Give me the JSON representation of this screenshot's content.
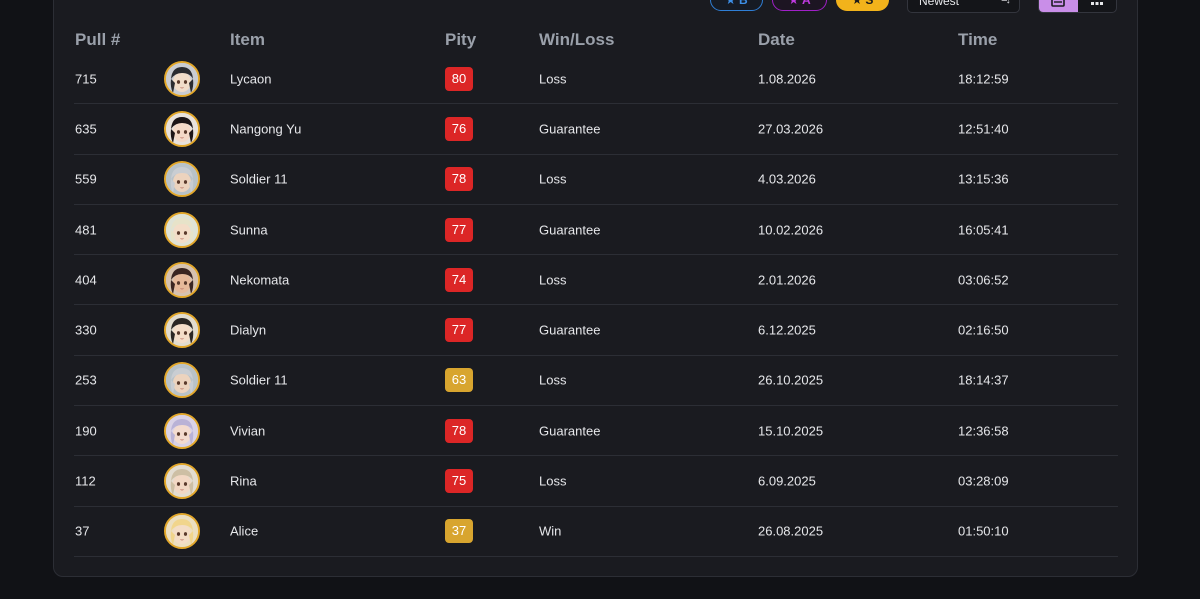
{
  "filters": {
    "b_label": "B",
    "a_label": "A",
    "s_label": "S",
    "colors": {
      "b": "#3d8fe6",
      "a": "#c03ae0",
      "s": "#f2b31b"
    }
  },
  "sort": {
    "selected": "Newest"
  },
  "view": {
    "options": [
      "list",
      "grid"
    ],
    "active": "list"
  },
  "table": {
    "headers": {
      "pull": "Pull #",
      "item": "Item",
      "pity": "Pity",
      "result": "Win/Loss",
      "date": "Date",
      "time": "Time"
    },
    "rows": [
      {
        "pull": "715",
        "item": "Lycaon",
        "pity": "80",
        "pity_level": "high",
        "result": "Loss",
        "date": "1.08.2026",
        "time": "18:12:59",
        "avatar": "lycaon-portrait"
      },
      {
        "pull": "635",
        "item": "Nangong Yu",
        "pity": "76",
        "pity_level": "high",
        "result": "Guarantee",
        "date": "27.03.2026",
        "time": "12:51:40",
        "avatar": "nangong-yu-portrait"
      },
      {
        "pull": "559",
        "item": "Soldier 11",
        "pity": "78",
        "pity_level": "high",
        "result": "Loss",
        "date": "4.03.2026",
        "time": "13:15:36",
        "avatar": "soldier-11-portrait"
      },
      {
        "pull": "481",
        "item": "Sunna",
        "pity": "77",
        "pity_level": "high",
        "result": "Guarantee",
        "date": "10.02.2026",
        "time": "16:05:41",
        "avatar": "sunna-portrait"
      },
      {
        "pull": "404",
        "item": "Nekomata",
        "pity": "74",
        "pity_level": "high",
        "result": "Loss",
        "date": "2.01.2026",
        "time": "03:06:52",
        "avatar": "nekomata-portrait"
      },
      {
        "pull": "330",
        "item": "Dialyn",
        "pity": "77",
        "pity_level": "high",
        "result": "Guarantee",
        "date": "6.12.2025",
        "time": "02:16:50",
        "avatar": "dialyn-portrait"
      },
      {
        "pull": "253",
        "item": "Soldier 11",
        "pity": "63",
        "pity_level": "mid",
        "result": "Loss",
        "date": "26.10.2025",
        "time": "18:14:37",
        "avatar": "soldier-11-portrait"
      },
      {
        "pull": "190",
        "item": "Vivian",
        "pity": "78",
        "pity_level": "high",
        "result": "Guarantee",
        "date": "15.10.2025",
        "time": "12:36:58",
        "avatar": "vivian-portrait"
      },
      {
        "pull": "112",
        "item": "Rina",
        "pity": "75",
        "pity_level": "high",
        "result": "Loss",
        "date": "6.09.2025",
        "time": "03:28:09",
        "avatar": "rina-portrait"
      },
      {
        "pull": "37",
        "item": "Alice",
        "pity": "37",
        "pity_level": "mid",
        "result": "Win",
        "date": "26.08.2025",
        "time": "01:50:10",
        "avatar": "alice-portrait"
      }
    ]
  }
}
